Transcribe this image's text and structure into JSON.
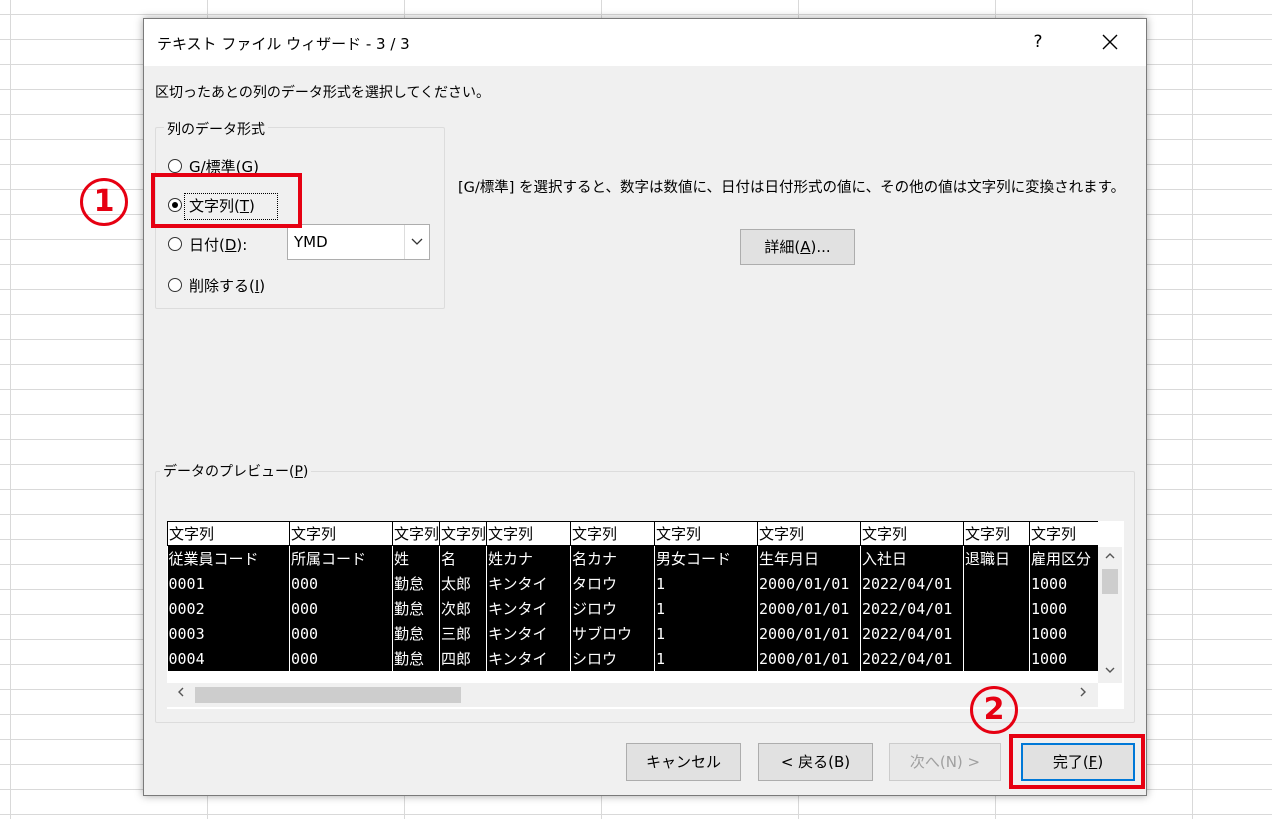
{
  "dialog": {
    "title": "テキスト ファイル ウィザード - 3 / 3",
    "help_label": "?",
    "instruction": "区切ったあとの列のデータ形式を選択してください。"
  },
  "format_group": {
    "legend": "列のデータ形式",
    "options": [
      {
        "label_before": "G/標準(",
        "accel": "G",
        "label_after": ")",
        "checked": false
      },
      {
        "label_before": "文字列(",
        "accel": "T",
        "label_after": ")",
        "checked": true
      },
      {
        "label_before": "日付(",
        "accel": "D",
        "label_after": "):",
        "checked": false
      },
      {
        "label_before": "削除する(",
        "accel": "I",
        "label_after": ")",
        "checked": false
      }
    ],
    "date_format_value": "YMD"
  },
  "description": "[G/標準] を選択すると、数字は数値に、日付は日付形式の値に、その他の値は文字列に変換されます。",
  "detail_button": {
    "before": "詳細(",
    "accel": "A",
    "after": ")..."
  },
  "preview": {
    "legend_before": "データのプレビュー(",
    "legend_accel": "P",
    "legend_after": ")",
    "headers": [
      "文字列",
      "文字列",
      "文字列",
      "文字列",
      "文字列",
      "文字列",
      "文字列",
      "文字列",
      "文字列",
      "文字列",
      "文字列"
    ],
    "rows": [
      [
        "従業員コード",
        "所属コード",
        "姓",
        "名",
        "姓カナ",
        "名カナ",
        "男女コード",
        "生年月日",
        "入社日",
        "退職日",
        "雇用区分"
      ],
      [
        "0001",
        "000",
        "勤怠",
        "太郎",
        "キンタイ",
        "タロウ",
        "1",
        "2000/01/01",
        "2022/04/01",
        "",
        "1000"
      ],
      [
        "0002",
        "000",
        "勤怠",
        "次郎",
        "キンタイ",
        "ジロウ",
        "1",
        "2000/01/01",
        "2022/04/01",
        "",
        "1000"
      ],
      [
        "0003",
        "000",
        "勤怠",
        "三郎",
        "キンタイ",
        "サブロウ",
        "1",
        "2000/01/01",
        "2022/04/01",
        "",
        "1000"
      ],
      [
        "0004",
        "000",
        "勤怠",
        "四郎",
        "キンタイ",
        "シロウ",
        "1",
        "2000/01/01",
        "2022/04/01",
        "",
        "1000"
      ]
    ]
  },
  "buttons": {
    "cancel": "キャンセル",
    "back": "< 戻る(B)",
    "next": "次へ(N) >",
    "finish_before": "完了(",
    "finish_accel": "F",
    "finish_after": ")"
  },
  "annotations": {
    "step1": "1",
    "step2": "2",
    "color": "#e60012"
  },
  "icons": {
    "close": "close-icon",
    "dropdown": "chevron-down-icon",
    "scroll_up": "chevron-up-icon",
    "scroll_down": "chevron-down-icon",
    "scroll_left": "chevron-left-icon",
    "scroll_right": "chevron-right-icon"
  }
}
